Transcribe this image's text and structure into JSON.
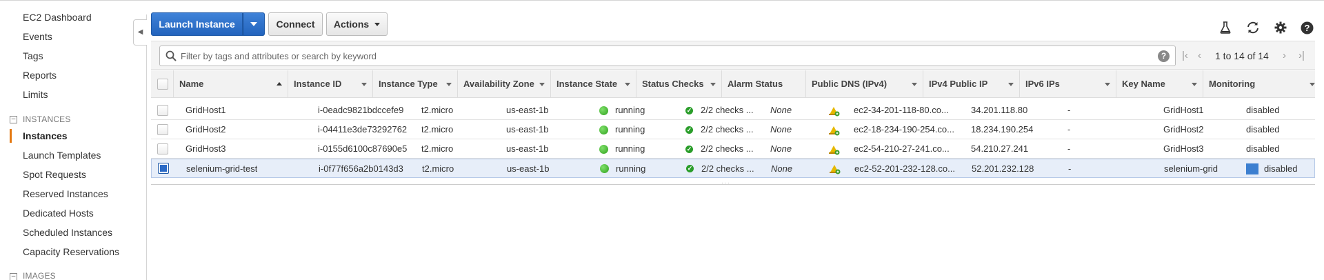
{
  "sidebar": {
    "items": [
      {
        "label": "EC2 Dashboard"
      },
      {
        "label": "Events"
      },
      {
        "label": "Tags"
      },
      {
        "label": "Reports"
      },
      {
        "label": "Limits"
      }
    ],
    "section_instances": "INSTANCES",
    "instances_items": [
      {
        "label": "Instances"
      },
      {
        "label": "Launch Templates"
      },
      {
        "label": "Spot Requests"
      },
      {
        "label": "Reserved Instances"
      },
      {
        "label": "Dedicated Hosts"
      },
      {
        "label": "Scheduled Instances"
      },
      {
        "label": "Capacity Reservations"
      }
    ],
    "section_images": "IMAGES"
  },
  "toolbar": {
    "launch_label": "Launch Instance",
    "connect_label": "Connect",
    "actions_label": "Actions",
    "icons": [
      "flask-icon",
      "refresh-icon",
      "gear-icon",
      "help-icon"
    ]
  },
  "search": {
    "placeholder": "Filter by tags and attributes or search by keyword",
    "pagination": "1 to 14 of 14"
  },
  "table": {
    "columns": [
      "Name",
      "Instance ID",
      "Instance Type",
      "Availability Zone",
      "Instance State",
      "Status Checks",
      "Alarm Status",
      "Public DNS (IPv4)",
      "IPv4 Public IP",
      "IPv6 IPs",
      "Key Name",
      "Monitoring"
    ],
    "rows": [
      {
        "name": "GridHost1",
        "id": "i-0eadc9821bdccefe9",
        "type": "t2.micro",
        "az": "us-east-1b",
        "state": "running",
        "checks": "2/2 checks ...",
        "alarm": "None",
        "dns": "ec2-34-201-118-80.co...",
        "ip": "34.201.118.80",
        "ipv6": "-",
        "key": "GridHost1",
        "monitoring": "disabled",
        "selected": false
      },
      {
        "name": "GridHost2",
        "id": "i-04411e3de73292762",
        "type": "t2.micro",
        "az": "us-east-1b",
        "state": "running",
        "checks": "2/2 checks ...",
        "alarm": "None",
        "dns": "ec2-18-234-190-254.co...",
        "ip": "18.234.190.254",
        "ipv6": "-",
        "key": "GridHost2",
        "monitoring": "disabled",
        "selected": false
      },
      {
        "name": "GridHost3",
        "id": "i-0155d6100c87690e5",
        "type": "t2.micro",
        "az": "us-east-1b",
        "state": "running",
        "checks": "2/2 checks ...",
        "alarm": "None",
        "dns": "ec2-54-210-27-241.co...",
        "ip": "54.210.27.241",
        "ipv6": "-",
        "key": "GridHost3",
        "monitoring": "disabled",
        "selected": false
      },
      {
        "name": "selenium-grid-test",
        "id": "i-0f77f656a2b0143d3",
        "type": "t2.micro",
        "az": "us-east-1b",
        "state": "running",
        "checks": "2/2 checks ...",
        "alarm": "None",
        "dns": "ec2-52-201-232-128.co...",
        "ip": "52.201.232.128",
        "ipv6": "-",
        "key": "selenium-grid",
        "monitoring": "disabled",
        "selected": true
      }
    ]
  },
  "colors": {
    "accent": "#2364bd",
    "active_marker": "#e47911",
    "running": "#2fa11e"
  }
}
